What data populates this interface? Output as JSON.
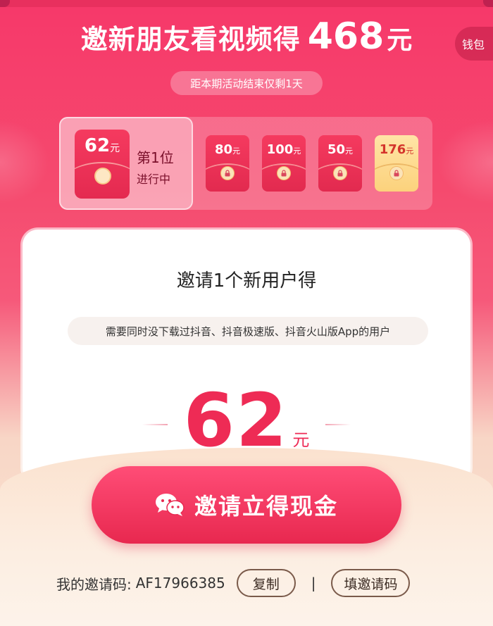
{
  "header": {
    "title": "邀新朋友看视频得",
    "amount": "468",
    "unit": "元",
    "wallet_label": "钱包"
  },
  "countdown": "距本期活动结束仅剩1天",
  "stages": {
    "current": {
      "amount": "62",
      "unit": "元",
      "rank": "第1位",
      "status": "进行中"
    },
    "locked": [
      {
        "amount": "80",
        "unit": "元"
      },
      {
        "amount": "100",
        "unit": "元"
      },
      {
        "amount": "50",
        "unit": "元"
      },
      {
        "amount": "176",
        "unit": "元"
      }
    ]
  },
  "card": {
    "title": "邀请1个新用户得",
    "requirement": "需要同时没下载过抖音、抖音极速版、抖音火山版App的用户",
    "reward_amount": "62",
    "reward_unit": "元"
  },
  "invite_button": {
    "label": "邀请立得现金"
  },
  "invite_code": {
    "label": "我的邀请码:",
    "value": "AF17966385",
    "copy_label": "复制",
    "separator": "|",
    "fill_label": "填邀请码"
  },
  "colors": {
    "primary_red": "#ee2b55",
    "button_red": "#e8284f",
    "gold_packet": "#fcd27c"
  }
}
